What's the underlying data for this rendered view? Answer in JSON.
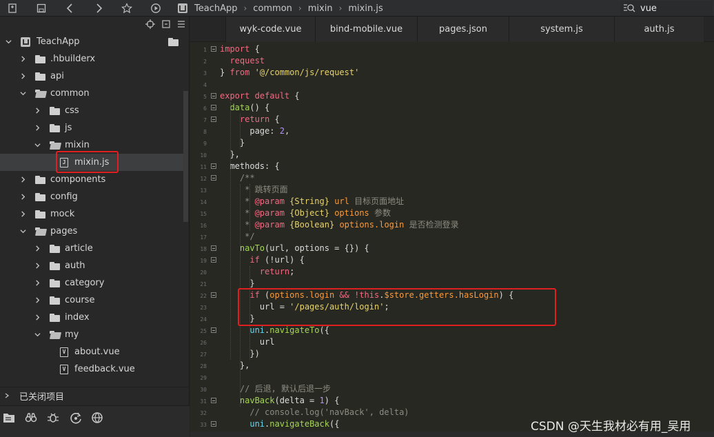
{
  "breadcrumb": [
    "TeachApp",
    "common",
    "mixin",
    "mixin.js"
  ],
  "search": {
    "value": "vue"
  },
  "tree": [
    {
      "label": "TeachApp",
      "type": "project",
      "depth": 0,
      "open": true
    },
    {
      "label": ".hbuilderx",
      "type": "folder",
      "depth": 1,
      "open": false
    },
    {
      "label": "api",
      "type": "folder",
      "depth": 1,
      "open": false
    },
    {
      "label": "common",
      "type": "folder",
      "depth": 1,
      "open": true
    },
    {
      "label": "css",
      "type": "folder",
      "depth": 2,
      "open": false
    },
    {
      "label": "js",
      "type": "folder",
      "depth": 2,
      "open": false
    },
    {
      "label": "mixin",
      "type": "folder",
      "depth": 2,
      "open": true
    },
    {
      "label": "mixin.js",
      "type": "file",
      "depth": 3,
      "icon": "J",
      "selected": true
    },
    {
      "label": "components",
      "type": "folder",
      "depth": 1,
      "open": false
    },
    {
      "label": "config",
      "type": "folder",
      "depth": 1,
      "open": false
    },
    {
      "label": "mock",
      "type": "folder",
      "depth": 1,
      "open": false
    },
    {
      "label": "pages",
      "type": "folder",
      "depth": 1,
      "open": true
    },
    {
      "label": "article",
      "type": "folder",
      "depth": 2,
      "open": false
    },
    {
      "label": "auth",
      "type": "folder",
      "depth": 2,
      "open": false
    },
    {
      "label": "category",
      "type": "folder",
      "depth": 2,
      "open": false
    },
    {
      "label": "course",
      "type": "folder",
      "depth": 2,
      "open": false
    },
    {
      "label": "index",
      "type": "folder",
      "depth": 2,
      "open": false
    },
    {
      "label": "my",
      "type": "folder",
      "depth": 2,
      "open": true
    },
    {
      "label": "about.vue",
      "type": "file",
      "depth": 3,
      "icon": "V"
    },
    {
      "label": "feedback.vue",
      "type": "file",
      "depth": 3,
      "icon": "V"
    }
  ],
  "closed_projects": {
    "label": "已关闭项目"
  },
  "tabs": [
    "wyk-code.vue",
    "bind-mobile.vue",
    "pages.json",
    "system.js",
    "auth.js"
  ],
  "code": [
    {
      "n": "1",
      "fold": true,
      "t": [
        [
          "kw",
          "import"
        ],
        [
          "pl",
          " {"
        ]
      ]
    },
    {
      "n": "2",
      "t": [
        [
          "pl",
          "  "
        ],
        [
          "kw",
          "request"
        ]
      ]
    },
    {
      "n": "3",
      "t": [
        [
          "pl",
          "} "
        ],
        [
          "kw",
          "from"
        ],
        [
          "pl",
          " "
        ],
        [
          "str",
          "'@/common/js/request'"
        ]
      ]
    },
    {
      "n": "4",
      "t": []
    },
    {
      "n": "5",
      "fold": true,
      "t": [
        [
          "kw",
          "export default"
        ],
        [
          "pl",
          " {"
        ]
      ]
    },
    {
      "n": "6",
      "fold": true,
      "t": [
        [
          "pl",
          "  "
        ],
        [
          "fn",
          "data"
        ],
        [
          "pl",
          "() {"
        ]
      ]
    },
    {
      "n": "7",
      "fold": true,
      "t": [
        [
          "pl",
          "    "
        ],
        [
          "kw",
          "return"
        ],
        [
          "pl",
          " {"
        ]
      ]
    },
    {
      "n": "8",
      "t": [
        [
          "pl",
          "      page: "
        ],
        [
          "num",
          "2"
        ],
        [
          "pl",
          ","
        ]
      ]
    },
    {
      "n": "9",
      "t": [
        [
          "pl",
          "    }"
        ]
      ]
    },
    {
      "n": "10",
      "t": [
        [
          "pl",
          "  },"
        ]
      ]
    },
    {
      "n": "11",
      "fold": true,
      "t": [
        [
          "pl",
          "  methods: {"
        ]
      ]
    },
    {
      "n": "12",
      "fold": true,
      "t": [
        [
          "cm",
          "    /**"
        ]
      ]
    },
    {
      "n": "13",
      "t": [
        [
          "cm",
          "     * 跳转页面"
        ]
      ]
    },
    {
      "n": "14",
      "t": [
        [
          "cm",
          "     * "
        ],
        [
          "tg",
          "@param"
        ],
        [
          "cm",
          " "
        ],
        [
          "str",
          "{String}"
        ],
        [
          "cm",
          " "
        ],
        [
          "pm",
          "url"
        ],
        [
          "cm",
          " 目标页面地址"
        ]
      ]
    },
    {
      "n": "15",
      "t": [
        [
          "cm",
          "     * "
        ],
        [
          "tg",
          "@param"
        ],
        [
          "cm",
          " "
        ],
        [
          "str",
          "{Object}"
        ],
        [
          "cm",
          " "
        ],
        [
          "pm",
          "options"
        ],
        [
          "cm",
          " 参数"
        ]
      ]
    },
    {
      "n": "16",
      "t": [
        [
          "cm",
          "     * "
        ],
        [
          "tg",
          "@param"
        ],
        [
          "cm",
          " "
        ],
        [
          "str",
          "{Boolean}"
        ],
        [
          "cm",
          " "
        ],
        [
          "pm",
          "options.login"
        ],
        [
          "cm",
          " 是否检测登录"
        ]
      ]
    },
    {
      "n": "17",
      "t": [
        [
          "cm",
          "     */"
        ]
      ]
    },
    {
      "n": "18",
      "fold": true,
      "t": [
        [
          "pl",
          "    "
        ],
        [
          "fn",
          "navTo"
        ],
        [
          "pl",
          "(url, options = {}) {"
        ]
      ]
    },
    {
      "n": "19",
      "fold": true,
      "t": [
        [
          "pl",
          "      "
        ],
        [
          "kw",
          "if"
        ],
        [
          "pl",
          " (!url) {"
        ]
      ]
    },
    {
      "n": "20",
      "t": [
        [
          "pl",
          "        "
        ],
        [
          "kw",
          "return"
        ],
        [
          "pl",
          ";"
        ]
      ]
    },
    {
      "n": "21",
      "t": [
        [
          "pl",
          "      }"
        ]
      ]
    },
    {
      "n": "22",
      "fold": true,
      "t": [
        [
          "pl",
          "      "
        ],
        [
          "kw",
          "if"
        ],
        [
          "pl",
          " ("
        ],
        [
          "pm",
          "options.login"
        ],
        [
          "pl",
          " "
        ],
        [
          "kw",
          "&&"
        ],
        [
          "pl",
          " "
        ],
        [
          "kw",
          "!this"
        ],
        [
          "pl",
          "."
        ],
        [
          "pm",
          "$store.getters.hasLogin"
        ],
        [
          "pl",
          ") {"
        ]
      ]
    },
    {
      "n": "23",
      "t": [
        [
          "pl",
          "        url = "
        ],
        [
          "str",
          "'/pages/auth/login'"
        ],
        [
          "pl",
          ";"
        ]
      ]
    },
    {
      "n": "24",
      "t": [
        [
          "pl",
          "      }"
        ]
      ]
    },
    {
      "n": "25",
      "fold": true,
      "t": [
        [
          "pl",
          "      "
        ],
        [
          "ty",
          "uni"
        ],
        [
          "pl",
          "."
        ],
        [
          "fn",
          "navigateTo"
        ],
        [
          "pl",
          "({"
        ]
      ]
    },
    {
      "n": "26",
      "t": [
        [
          "pl",
          "        url"
        ]
      ]
    },
    {
      "n": "27",
      "t": [
        [
          "pl",
          "      })"
        ]
      ]
    },
    {
      "n": "28",
      "t": [
        [
          "pl",
          "    },"
        ]
      ]
    },
    {
      "n": "29",
      "t": []
    },
    {
      "n": "30",
      "t": [
        [
          "cm",
          "    // 后退, 默认后退一步"
        ]
      ]
    },
    {
      "n": "31",
      "fold": true,
      "t": [
        [
          "pl",
          "    "
        ],
        [
          "fn",
          "navBack"
        ],
        [
          "pl",
          "(delta = "
        ],
        [
          "num",
          "1"
        ],
        [
          "pl",
          ") {"
        ]
      ]
    },
    {
      "n": "32",
      "t": [
        [
          "cm",
          "      // console.log('navBack', delta)"
        ]
      ]
    },
    {
      "n": "33",
      "fold": true,
      "t": [
        [
          "pl",
          "      "
        ],
        [
          "ty",
          "uni"
        ],
        [
          "pl",
          "."
        ],
        [
          "fn",
          "navigateBack"
        ],
        [
          "pl",
          "({"
        ]
      ]
    }
  ],
  "watermark": "CSDN @天生我材必有用_吴用"
}
